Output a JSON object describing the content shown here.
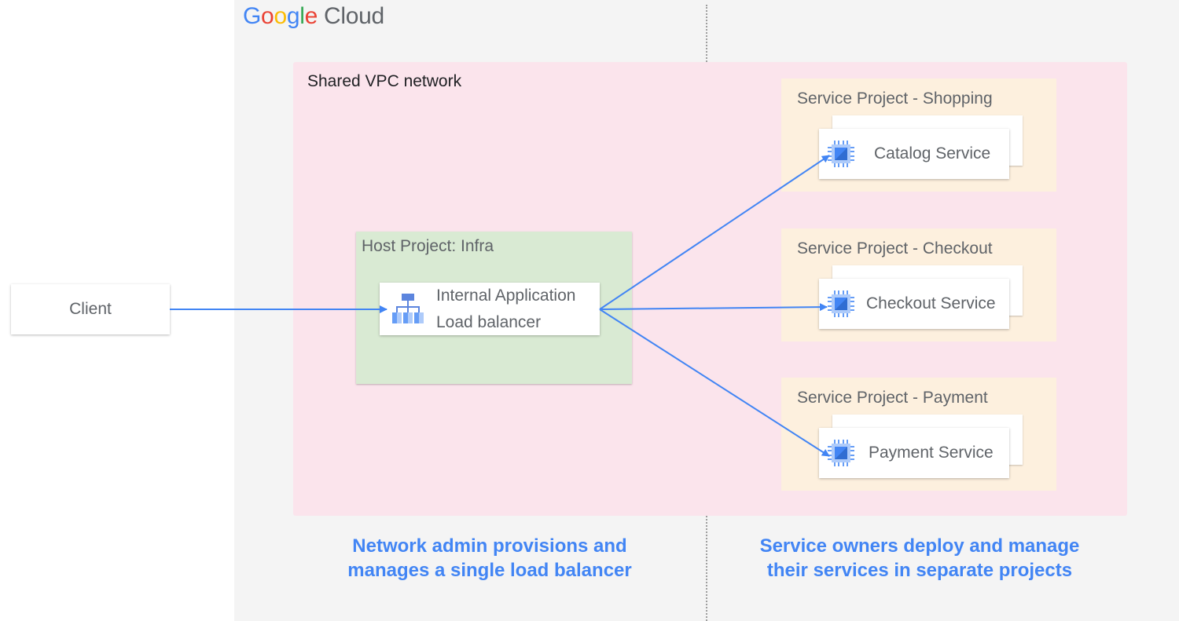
{
  "logo": {
    "google_letters": [
      "G",
      "o",
      "o",
      "g",
      "l",
      "e"
    ],
    "google_colors": [
      "#4285F4",
      "#EA4335",
      "#FBBC05",
      "#4285F4",
      "#34A853",
      "#EA4335"
    ],
    "cloud": "Cloud"
  },
  "shared_vpc": {
    "label": "Shared VPC network",
    "color": "#fbe4ec"
  },
  "client": {
    "label": "Client"
  },
  "host_project": {
    "label": "Host Project: Infra",
    "load_balancer": {
      "line1": "Internal Application",
      "line2": "Load balancer",
      "icon": "load-balancer-icon"
    }
  },
  "service_projects": [
    {
      "label": "Service Project - Shopping",
      "service": "Catalog Service",
      "icon": "compute-chip-icon"
    },
    {
      "label": "Service Project - Checkout",
      "service": "Checkout Service",
      "icon": "compute-chip-icon"
    },
    {
      "label": "Service Project - Payment",
      "service": "Payment Service",
      "icon": "compute-chip-icon"
    }
  ],
  "captions": {
    "left_line1": "Network admin provisions and",
    "left_line2": "manages a single load balancer",
    "right_line1": "Service owners deploy and manage",
    "right_line2": "their services in separate projects"
  },
  "colors": {
    "arrow": "#4285f4",
    "accent_text": "#4285f4",
    "host_bg": "#d9ead3",
    "service_bg": "#fdf0de"
  }
}
